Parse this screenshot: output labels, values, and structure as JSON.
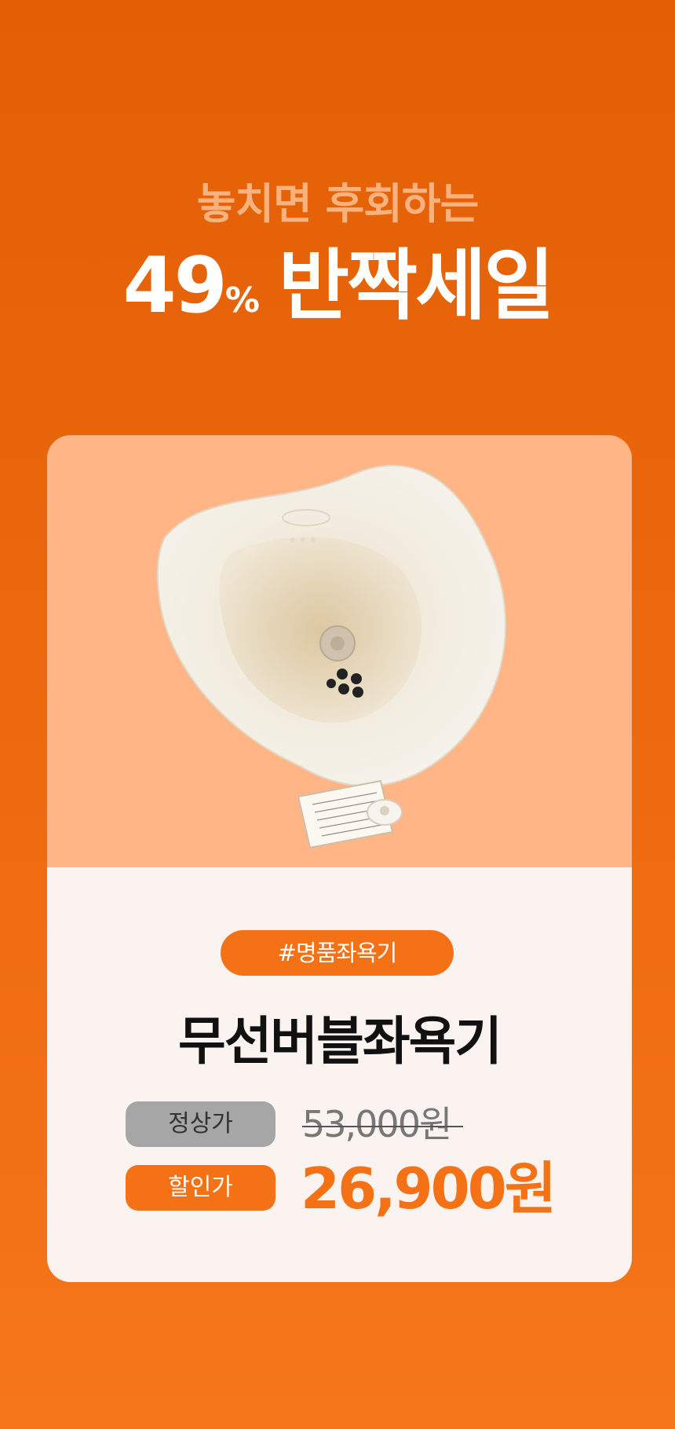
{
  "headline": {
    "sub": "놓치면 후회하는",
    "percent_number": "49",
    "percent_sign": "%",
    "sale": "반짝세일"
  },
  "product": {
    "image_icon": "sitz-bath-basin-photo",
    "tag": "#명품좌욕기",
    "name": "무선버블좌욕기",
    "regular_label": "정상가",
    "regular_price": "53,000원",
    "discount_label": "할인가",
    "discount_price": "26,900원"
  },
  "colors": {
    "background": "#E8640A",
    "accent": "#F47116",
    "photo_bg": "#FFB585",
    "card_bg": "#FAF3EF"
  }
}
